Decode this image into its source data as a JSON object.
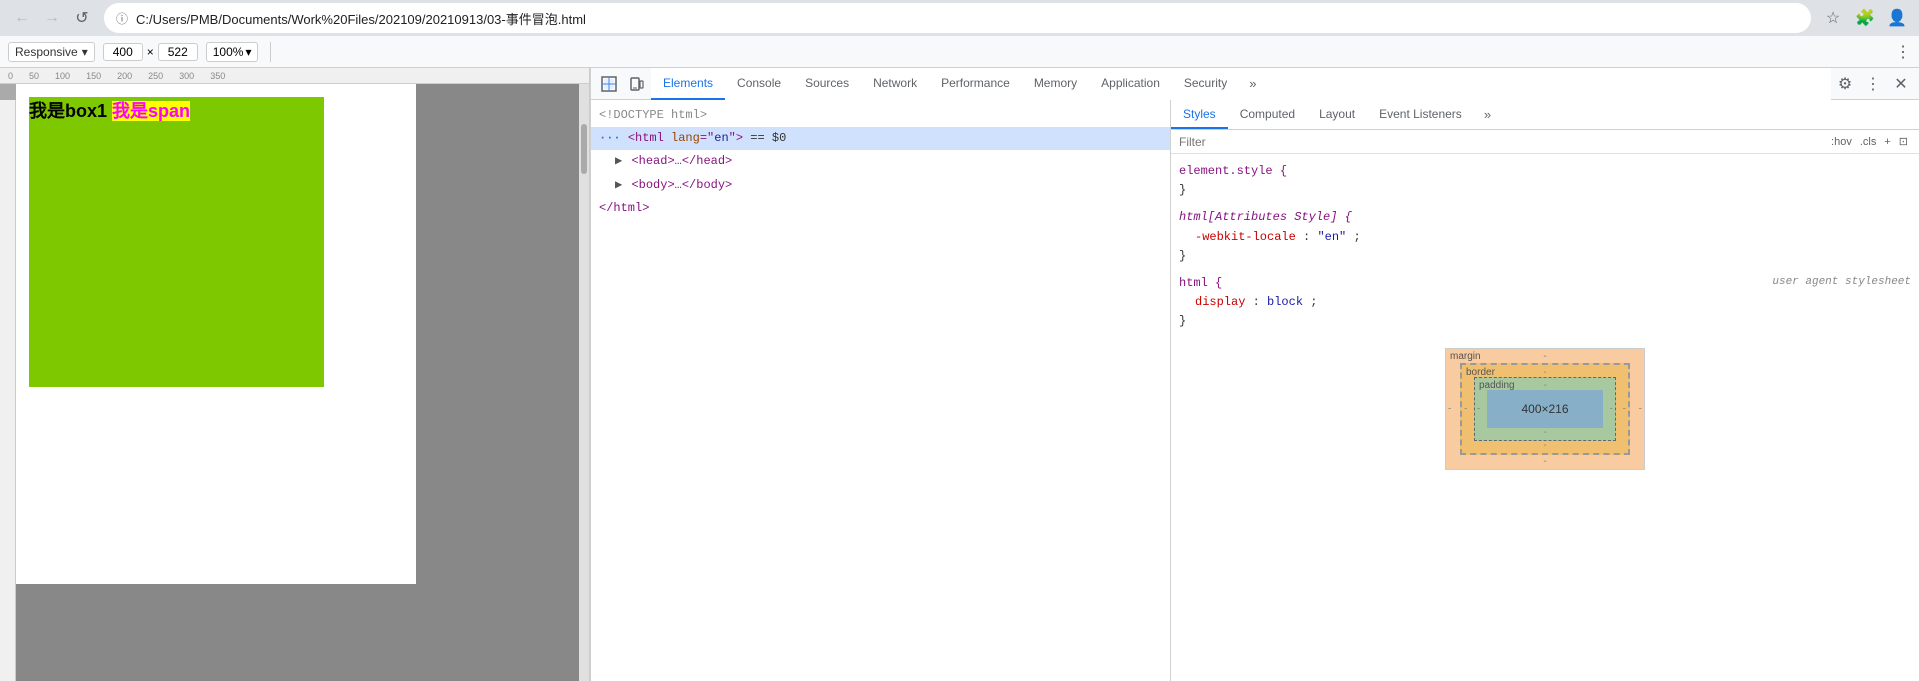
{
  "browser": {
    "back_label": "←",
    "forward_label": "→",
    "reload_label": "↺",
    "url": "C:/Users/PMB/Documents/Work%20Files/202109/20210913/03-事件冒泡.html",
    "favicon_label": "ⓘ",
    "bookmark_label": "☆",
    "extensions_label": "🧩",
    "profile_label": "👤"
  },
  "viewport_toolbar": {
    "device": "Responsive",
    "device_dropdown": "▾",
    "width": "400",
    "cross_label": "×",
    "height": "522",
    "zoom": "100%",
    "zoom_dropdown": "▾",
    "more_label": "⋮"
  },
  "webpage": {
    "box1_text": "我是box1 ",
    "span_text": "我是span"
  },
  "devtools": {
    "cursor_icon_label": "⬚",
    "device_icon_label": "📱",
    "tabs": [
      {
        "id": "elements",
        "label": "Elements",
        "active": true
      },
      {
        "id": "console",
        "label": "Console",
        "active": false
      },
      {
        "id": "sources",
        "label": "Sources",
        "active": false
      },
      {
        "id": "network",
        "label": "Network",
        "active": false
      },
      {
        "id": "performance",
        "label": "Performance",
        "active": false
      },
      {
        "id": "memory",
        "label": "Memory",
        "active": false
      },
      {
        "id": "application",
        "label": "Application",
        "active": false
      },
      {
        "id": "security",
        "label": "Security",
        "active": false
      }
    ],
    "more_tabs_label": "»",
    "settings_label": "⚙",
    "more_options_label": "⋮",
    "close_label": "✕",
    "dom": {
      "doctype": "<!DOCTYPE html>",
      "html_line": "···<html lang=\"en\"> == $0",
      "head_line": "▶ <head>…</head>",
      "body_line": "▶ <body>…</body>",
      "close_html": "</html>"
    },
    "styles": {
      "tabs": [
        {
          "id": "styles",
          "label": "Styles",
          "active": true
        },
        {
          "id": "computed",
          "label": "Computed",
          "active": false
        },
        {
          "id": "layout",
          "label": "Layout",
          "active": false
        },
        {
          "id": "event-listeners",
          "label": "Event Listeners",
          "active": false
        }
      ],
      "more_label": "»",
      "filter_placeholder": "Filter",
      "hov_label": ":hov",
      "cls_label": ".cls",
      "plus_label": "+",
      "collapse_label": "⊡",
      "rules": [
        {
          "selector": "element.style {",
          "close": "}",
          "properties": []
        },
        {
          "selector": "html[Attributes Style] {",
          "close": "}",
          "properties": [
            {
              "name": "-webkit-locale",
              "value": "\"en\"",
              "color": "red"
            }
          ]
        },
        {
          "selector": "html {",
          "note": "user agent stylesheet",
          "close": "}",
          "properties": [
            {
              "name": "display",
              "value": "block",
              "color": "normal"
            }
          ]
        }
      ],
      "box_model": {
        "margin_label": "margin",
        "border_label": "border",
        "padding_label": "padding",
        "size_label": "400×216",
        "dashes": "-"
      }
    }
  }
}
